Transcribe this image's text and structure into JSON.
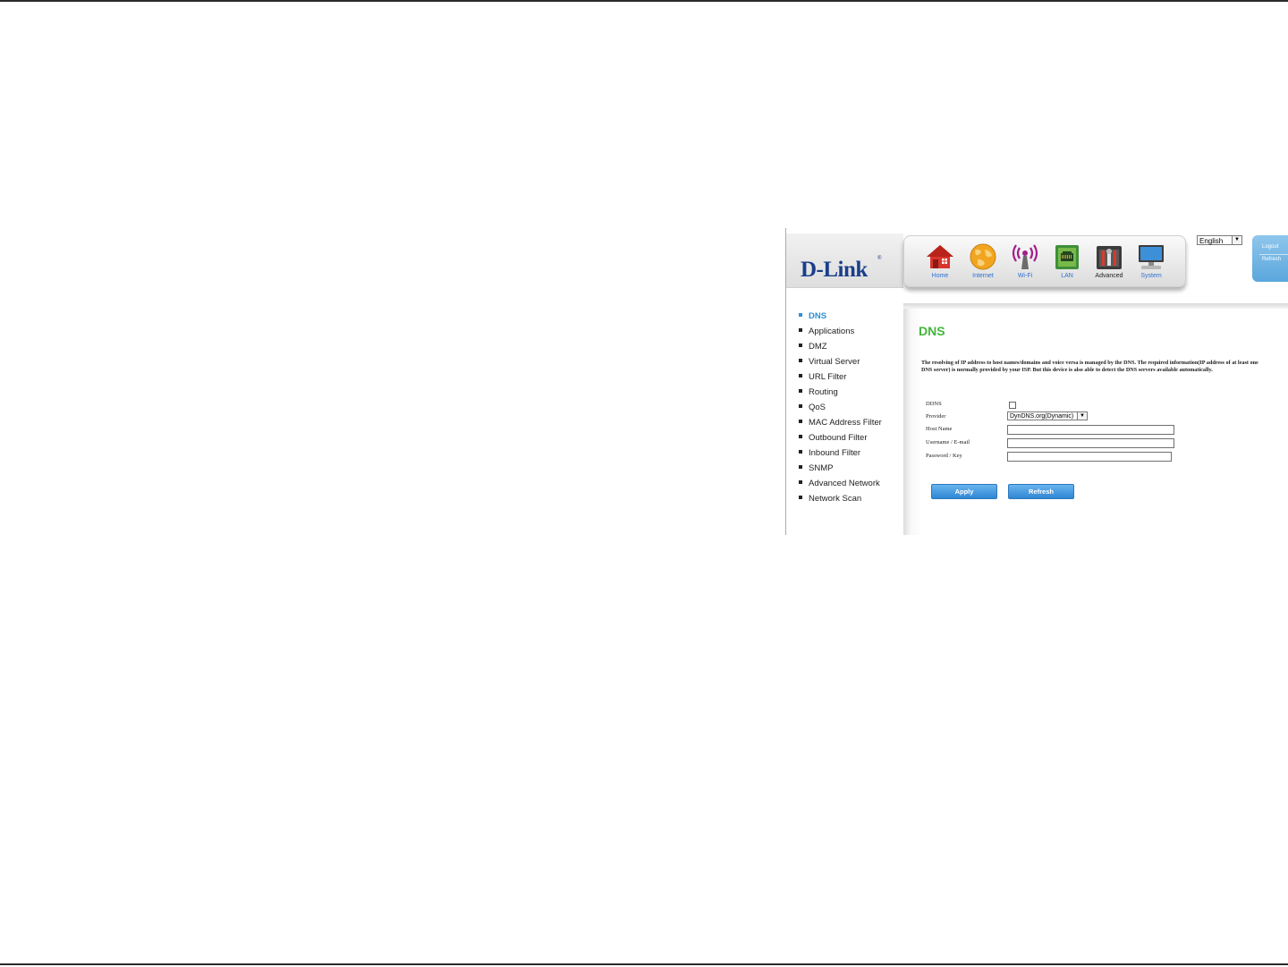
{
  "header": {
    "logo_text": "D-Link",
    "logo_mark": "®",
    "nav": [
      {
        "label": "Home",
        "icon": "home-icon",
        "active": false
      },
      {
        "label": "Internet",
        "icon": "globe-icon",
        "active": false
      },
      {
        "label": "Wi-Fi",
        "icon": "wifi-icon",
        "active": false
      },
      {
        "label": "LAN",
        "icon": "lan-icon",
        "active": false
      },
      {
        "label": "Advanced",
        "icon": "advanced-tools-icon",
        "active": true
      },
      {
        "label": "System",
        "icon": "monitor-icon",
        "active": false
      }
    ],
    "language": {
      "selected": "English"
    },
    "side_links": {
      "logout": "Logout",
      "refresh": "Refresh"
    }
  },
  "menu": {
    "items": [
      {
        "label": "DNS",
        "active": true
      },
      {
        "label": "Applications"
      },
      {
        "label": "DMZ"
      },
      {
        "label": "Virtual Server"
      },
      {
        "label": "URL Filter"
      },
      {
        "label": "Routing"
      },
      {
        "label": "QoS"
      },
      {
        "label": "MAC Address Filter"
      },
      {
        "label": "Outbound Filter"
      },
      {
        "label": "Inbound Filter"
      },
      {
        "label": "SNMP"
      },
      {
        "label": "Advanced Network"
      },
      {
        "label": "Network Scan"
      }
    ]
  },
  "content": {
    "title": "DNS",
    "description": "The resolving of IP address to host names/domains and voice versa is managed by the DNS. The required information(IP address of at least one DNS server) is normally provided by your ISP. But this device is also able to detect the DNS servers available automatically.",
    "form": {
      "ddns_label": "DDNS",
      "ddns_checked": false,
      "provider_label": "Provider",
      "provider_value": "DynDNS.org(Dynamic)",
      "host_name_label": "Host Name",
      "host_name_value": "",
      "username_label": "Username / E-mail",
      "username_value": "",
      "password_label": "Password / Key",
      "password_value": ""
    },
    "buttons": {
      "apply": "Apply",
      "refresh": "Refresh"
    }
  },
  "colors": {
    "brand_blue": "#1a3e8a",
    "title_green": "#44b53c",
    "active_menu": "#2e8fd6",
    "button_blue": "#2f86d3"
  }
}
